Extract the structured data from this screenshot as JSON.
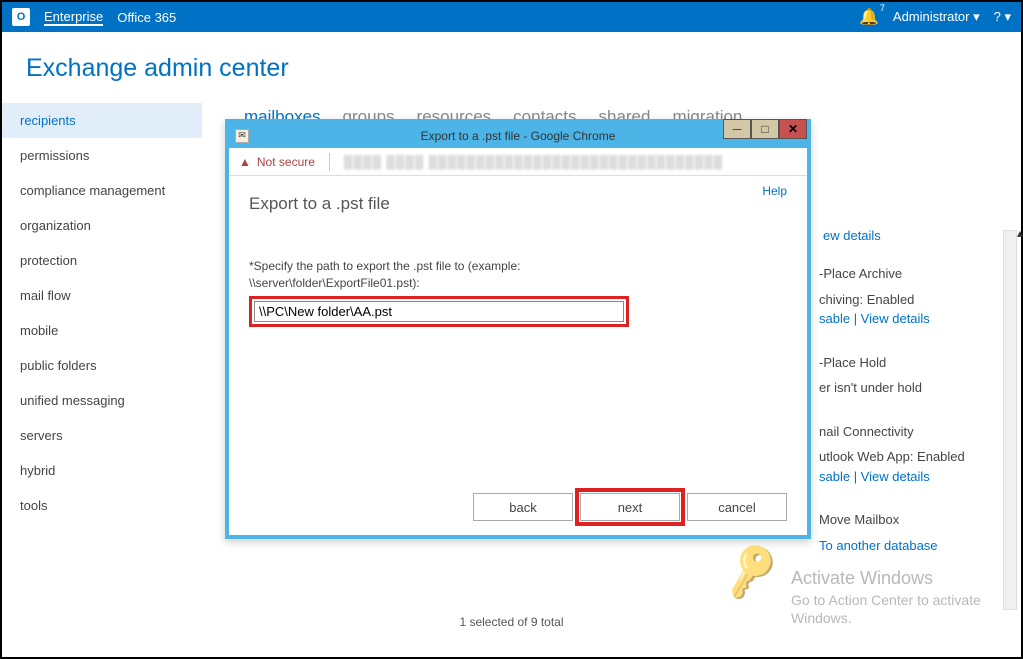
{
  "topbar": {
    "enterprise": "Enterprise",
    "office365": "Office 365",
    "notif_count": "7",
    "admin": "Administrator  ▾",
    "help": "?  ▾"
  },
  "page_title": "Exchange admin center",
  "sidebar": {
    "items": [
      {
        "label": "recipients",
        "active": true
      },
      {
        "label": "permissions"
      },
      {
        "label": "compliance management"
      },
      {
        "label": "organization"
      },
      {
        "label": "protection"
      },
      {
        "label": "mail flow"
      },
      {
        "label": "mobile"
      },
      {
        "label": "public folders"
      },
      {
        "label": "unified messaging"
      },
      {
        "label": "servers"
      },
      {
        "label": "hybrid"
      },
      {
        "label": "tools"
      }
    ]
  },
  "tabs": {
    "items": [
      {
        "label": "mailboxes",
        "active": true
      },
      {
        "label": "groups"
      },
      {
        "label": "resources"
      },
      {
        "label": "contacts"
      },
      {
        "label": "shared"
      },
      {
        "label": "migration"
      }
    ]
  },
  "rightpanel": {
    "view_details": "ew details",
    "archive": {
      "title": "-Place Archive",
      "enabled": "chiving:  Enabled",
      "links": "sable | View details"
    },
    "hold": {
      "title": "-Place Hold",
      "status": "er isn't under hold"
    },
    "conn": {
      "title": "nail Connectivity",
      "status": "utlook Web App:  Enabled",
      "links": "sable | View details"
    },
    "move": {
      "title": "Move Mailbox",
      "link": "To another database"
    }
  },
  "status": "1 selected of 9 total",
  "dialog": {
    "title": "Export to a .pst file - Google Chrome",
    "not_secure": "Not secure",
    "help": "Help",
    "heading": "Export to a .pst file",
    "label1": "*Specify the path to export the .pst file to (example:",
    "label2": "\\\\server\\folder\\ExportFile01.pst):",
    "input_value": "\\\\PC\\New folder\\AA.pst",
    "back": "back",
    "next": "next",
    "cancel": "cancel"
  },
  "watermark": {
    "h": "Activate Windows",
    "t": "Go to Action Center to activate Windows."
  }
}
